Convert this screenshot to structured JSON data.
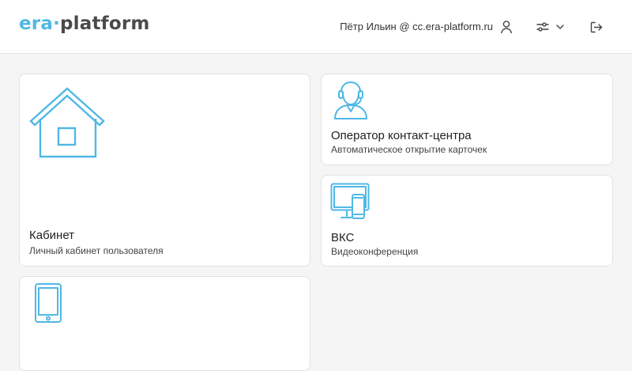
{
  "header": {
    "logo": {
      "era": "era",
      "dot": "·",
      "platform": "platform"
    },
    "user_label": "Пётр Ильин @ cc.era-platform.ru",
    "icons": {
      "user": "user-icon",
      "settings": "sliders-icon",
      "dropdown": "chevron-down-icon",
      "logout": "logout-icon"
    }
  },
  "cards": [
    {
      "title": "Кабинет",
      "subtitle": "Личный кабинет пользователя",
      "icon": "house-icon"
    },
    {
      "title": "Оператор контакт-центра",
      "subtitle": "Автоматическое открытие карточек",
      "icon": "operator-headset-icon"
    },
    {
      "title": "ВКС",
      "subtitle": "Видеоконференция",
      "icon": "monitor-phone-icon"
    },
    {
      "icon": "tablet-icon"
    }
  ],
  "colors": {
    "accent": "#4fb8e4",
    "logo_dark": "#4a4a4a",
    "background": "#f5f5f5",
    "card_border": "#e2e2e2"
  }
}
